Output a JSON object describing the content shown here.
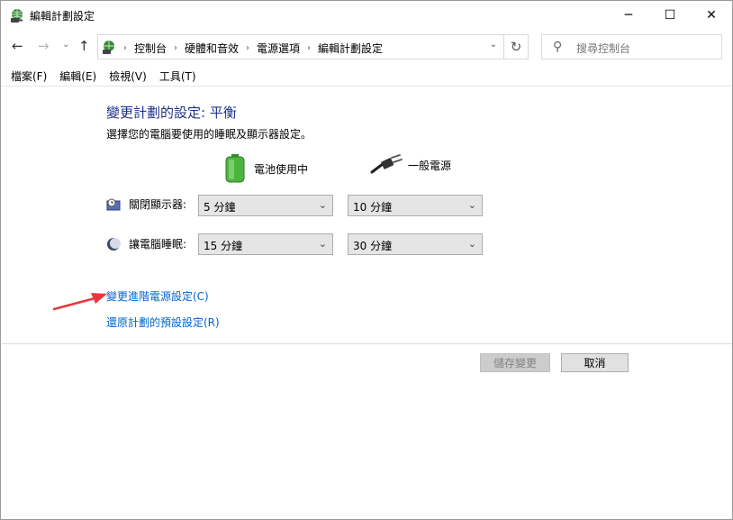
{
  "window": {
    "title": "編輯計劃設定",
    "minimize": "─",
    "maximize": "☐",
    "close": "✕"
  },
  "nav": {
    "back": "←",
    "forward": "→",
    "recent": "⌄",
    "up": "↑"
  },
  "address": {
    "crumbs": [
      "控制台",
      "硬體和音效",
      "電源選項",
      "編輯計劃設定"
    ],
    "separator": "›",
    "dropdown": "⌄",
    "refresh": "↻"
  },
  "search": {
    "icon": "⚲",
    "placeholder": "搜尋控制台"
  },
  "menu": [
    "檔案(F)",
    "編輯(E)",
    "檢視(V)",
    "工具(T)"
  ],
  "main": {
    "heading": "變更計劃的設定: 平衡",
    "subtext": "選擇您的電腦要使用的睡眠及顯示器設定。",
    "columns": {
      "battery": "電池使用中",
      "plugged": "一般電源"
    },
    "rows": [
      {
        "label": "關閉顯示器:",
        "battery": "5 分鐘",
        "plugged": "10 分鐘"
      },
      {
        "label": "讓電腦睡眠:",
        "battery": "15 分鐘",
        "plugged": "30 分鐘"
      }
    ],
    "links": {
      "advanced": "變更進階電源設定(C)",
      "restore": "還原計劃的預設設定(R)"
    }
  },
  "buttons": {
    "save": "儲存變更",
    "cancel": "取消"
  },
  "colors": {
    "heading": "#1e3287",
    "link": "#0066cc",
    "arrow": "#e8383d",
    "battery": "#4cb53f"
  }
}
